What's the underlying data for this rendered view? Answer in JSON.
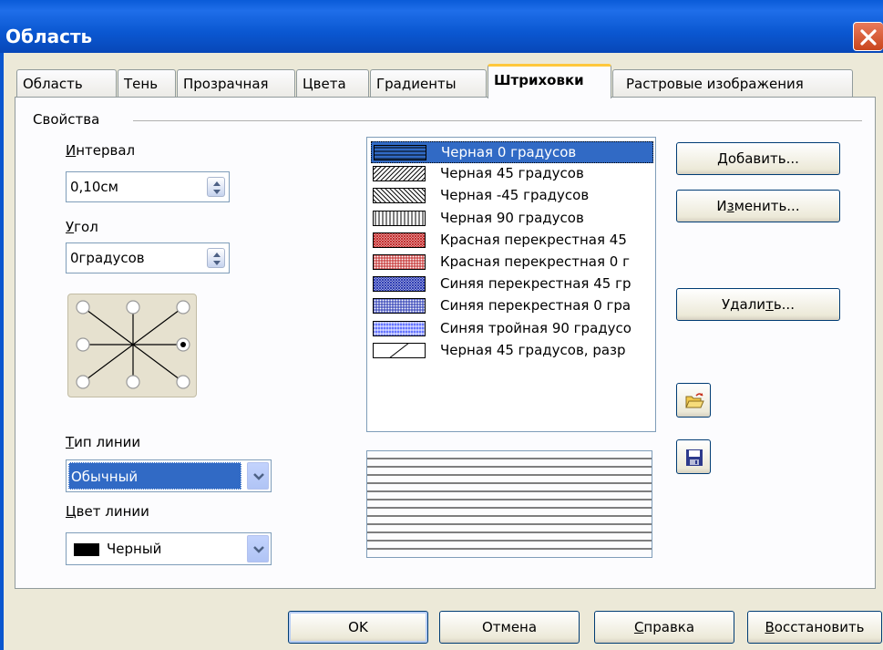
{
  "window": {
    "title": "Область"
  },
  "tabs": [
    {
      "label": "Область"
    },
    {
      "label": "Тень"
    },
    {
      "label": "Прозрачная"
    },
    {
      "label": "Цвета"
    },
    {
      "label": "Градиенты"
    },
    {
      "label": "Штриховки",
      "active": true
    },
    {
      "label": "Растровые изображения"
    }
  ],
  "properties": {
    "group_label": "Свойства",
    "spacing": {
      "label_ul": "И",
      "label_rest": "нтервал",
      "value": "0,10см"
    },
    "angle": {
      "label_ul": "У",
      "label_rest": "гол",
      "value": "0градусов"
    },
    "line_type": {
      "label_ul": "Т",
      "label_rest": "ип линии",
      "value": "Обычный"
    },
    "line_color": {
      "label_ul": "Ц",
      "label_rest": "вет линии",
      "value": "Черный",
      "swatch": "#000000"
    }
  },
  "hatches": [
    {
      "label": "Черная 0 градусов",
      "pattern": "h0",
      "color": "#000000",
      "selected": true
    },
    {
      "label": "Черная 45 градусов",
      "pattern": "d45",
      "color": "#000000"
    },
    {
      "label": "Черная -45 градусов",
      "pattern": "dm45",
      "color": "#000000"
    },
    {
      "label": "Черная 90 градусов",
      "pattern": "v90",
      "color": "#000000"
    },
    {
      "label": "Красная перекрестная 45",
      "pattern": "x45",
      "color": "#c02020"
    },
    {
      "label": "Красная перекрестная 0 г",
      "pattern": "grid",
      "color": "#c02020"
    },
    {
      "label": "Синяя перекрестная 45 гр",
      "pattern": "x45",
      "color": "#2030b0"
    },
    {
      "label": "Синяя перекрестная 0 гра",
      "pattern": "grid",
      "color": "#2030b0"
    },
    {
      "label": "Синяя тройная 90 градусо",
      "pattern": "triple",
      "color": "#1a30ff"
    },
    {
      "label": "Черная 45 градусов, разр",
      "pattern": "wide",
      "color": "#000000"
    }
  ],
  "side_buttons": {
    "add": {
      "pre": "",
      "ul": "Д",
      "post": "обавить..."
    },
    "modify": {
      "pre": "И",
      "ul": "з",
      "post": "менить..."
    },
    "delete": {
      "pre": "Удали",
      "ul": "т",
      "post": "ь..."
    },
    "load_icon": "open-folder-icon",
    "save_icon": "floppy-disk-icon"
  },
  "footer": {
    "ok": "OK",
    "cancel": "Отмена",
    "help": {
      "pre": "",
      "ul": "С",
      "post": "правка"
    },
    "reset": {
      "pre": "",
      "ul": "В",
      "post": "осстановить"
    }
  },
  "colors": {
    "titlebar": "#0a5bd8",
    "selection": "#316ac5",
    "dialog_bg": "#ece9d8",
    "active_tab_accent": "#ffc83c"
  }
}
